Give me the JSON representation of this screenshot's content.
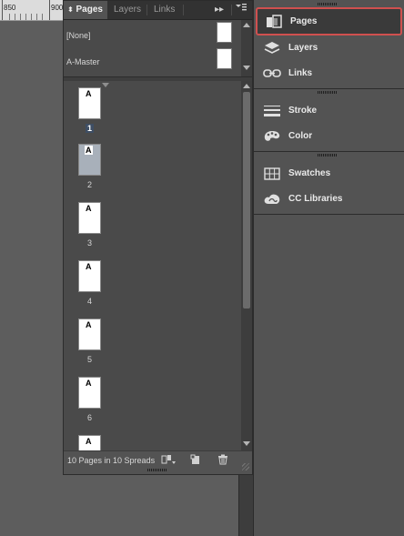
{
  "ruler": {
    "left_number": "850",
    "right_number": "900"
  },
  "panel": {
    "tabs": [
      {
        "label": "Pages",
        "icon": "panel-collapse-arrows-icon"
      },
      {
        "label": "Layers"
      },
      {
        "label": "Links"
      }
    ],
    "overflow_icon": "double-chevron-right-icon",
    "menu_icon": "panel-menu-icon",
    "masters": [
      {
        "label": "[None]"
      },
      {
        "label": "A-Master"
      }
    ],
    "pages": [
      {
        "number": "1",
        "master": "A",
        "selected": false,
        "number_highlighted": true
      },
      {
        "number": "2",
        "master": "A",
        "selected": true,
        "number_highlighted": false
      },
      {
        "number": "3",
        "master": "A",
        "selected": false,
        "number_highlighted": false
      },
      {
        "number": "4",
        "master": "A",
        "selected": false,
        "number_highlighted": false
      },
      {
        "number": "5",
        "master": "A",
        "selected": false,
        "number_highlighted": false
      },
      {
        "number": "6",
        "master": "A",
        "selected": false,
        "number_highlighted": false
      },
      {
        "number": "",
        "master": "A",
        "selected": false,
        "number_highlighted": false
      }
    ],
    "status": "10 Pages in 10 Spreads",
    "footer_icons": [
      "edit-page-size-icon",
      "new-page-icon",
      "delete-page-icon"
    ]
  },
  "dock": {
    "groups": [
      [
        {
          "label": "Pages",
          "icon": "pages-icon",
          "active": true
        },
        {
          "label": "Layers",
          "icon": "layers-icon",
          "active": false
        },
        {
          "label": "Links",
          "icon": "links-icon",
          "active": false
        }
      ],
      [
        {
          "label": "Stroke",
          "icon": "stroke-icon",
          "active": false
        },
        {
          "label": "Color",
          "icon": "color-palette-icon",
          "active": false
        }
      ],
      [
        {
          "label": "Swatches",
          "icon": "swatches-icon",
          "active": false
        },
        {
          "label": "CC Libraries",
          "icon": "cc-libraries-icon",
          "active": false
        }
      ]
    ]
  },
  "colors": {
    "active_outline": "#d0504f",
    "panel_bg": "#535353",
    "page_selected_bg": "#a8b0ba",
    "page_number_highlight": "#3e4e64"
  }
}
